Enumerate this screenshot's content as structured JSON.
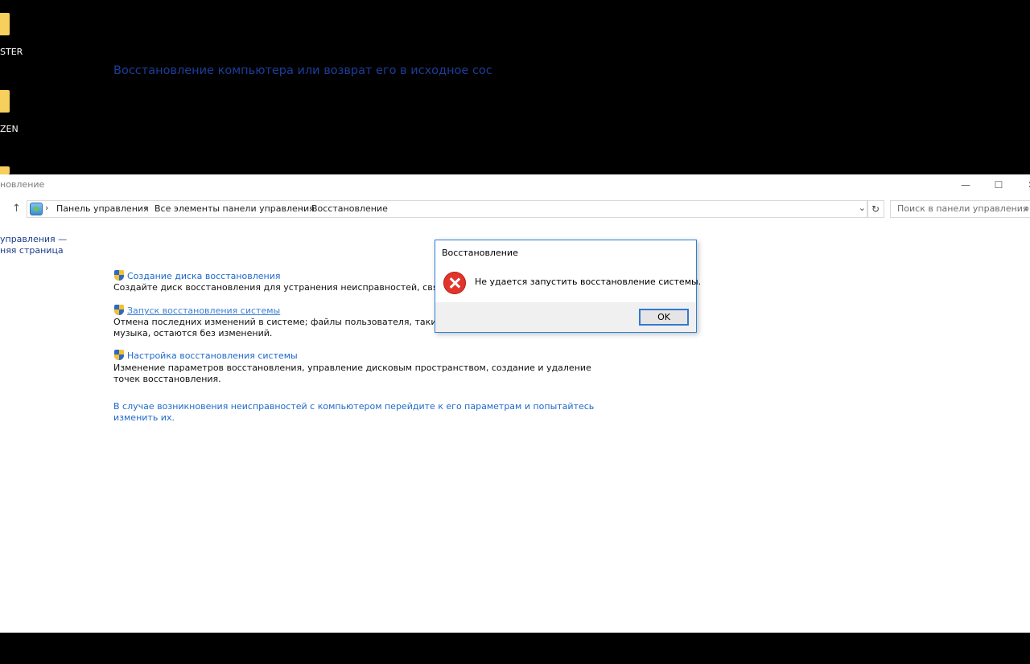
{
  "desktop": {
    "icons": [
      {
        "label": "STER"
      },
      {
        "label": "ZEN"
      }
    ]
  },
  "window": {
    "title": "новление",
    "controls": {
      "minimize": "—",
      "maximize": "☐",
      "close": "✕"
    },
    "nav": {
      "back": "→",
      "up": "↑"
    },
    "breadcrumb": [
      "Панель управления",
      "Все элементы панели управления",
      "Восстановление"
    ],
    "breadcrumb_sep": "›",
    "search": {
      "placeholder": "Поиск в панели управления"
    },
    "sidebar": {
      "line1": "управления —",
      "line2": "няя страница"
    }
  },
  "main": {
    "title": "Восстановление компьютера или возврат его в исходное сос",
    "tasks": [
      {
        "link": "Создание диска восстановления",
        "desc": [
          "Создайте диск восстановления для устранения неисправностей, связанных с з"
        ]
      },
      {
        "link": "Запуск восстановления системы",
        "desc": [
          "Отмена последних изменений в системе; файлы пользователя, такие как доку",
          "музыка, остаются без изменений."
        ]
      },
      {
        "link": "Настройка восстановления системы",
        "desc": [
          "Изменение параметров восстановления, управление дисковым пространством, создание и удаление",
          "точек восстановления."
        ]
      }
    ],
    "bottom_link": [
      "В случае возникновения неисправностей с компьютером перейдите к его параметрам и попытайтесь",
      "изменить их."
    ]
  },
  "dialog": {
    "title": "Восстановление",
    "message": "Не удается запустить восстановление системы.",
    "ok": "OK"
  }
}
